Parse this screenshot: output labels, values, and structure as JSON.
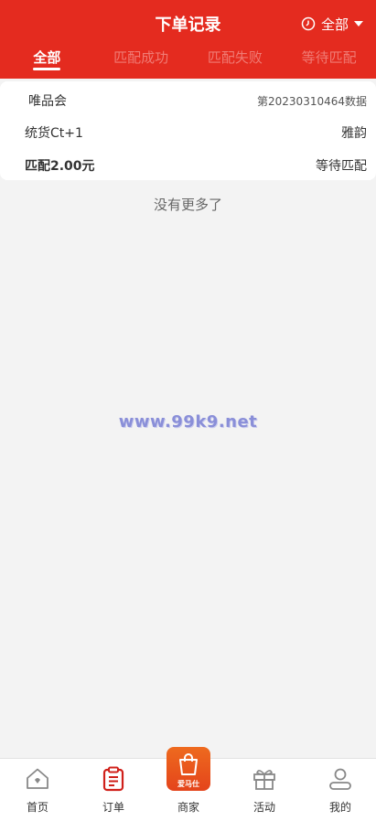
{
  "header": {
    "title": "下单记录",
    "filter_label": "全部",
    "background_color": "#e42b1f"
  },
  "tabs": [
    {
      "label": "全部",
      "active": true
    },
    {
      "label": "匹配成功",
      "active": false
    },
    {
      "label": "匹配失败",
      "active": false
    },
    {
      "label": "等待匹配",
      "active": false
    }
  ],
  "order": {
    "platform": "唯品会",
    "serial": "第20230310464数据",
    "product": "统货Ct+1",
    "shop": "雅韵",
    "amount": "匹配2.00元",
    "status": "等待匹配"
  },
  "list_footer": "没有更多了",
  "watermark": "www.99k9.net",
  "bottom_nav": {
    "items": [
      {
        "label": "首页",
        "icon": "home-icon"
      },
      {
        "label": "订单",
        "icon": "clipboard-icon",
        "active": true
      },
      {
        "label": "商家",
        "icon": "shopping-bag-icon",
        "badge_text": "爱马仕"
      },
      {
        "label": "活动",
        "icon": "gift-icon"
      },
      {
        "label": "我的",
        "icon": "user-icon"
      }
    ]
  }
}
